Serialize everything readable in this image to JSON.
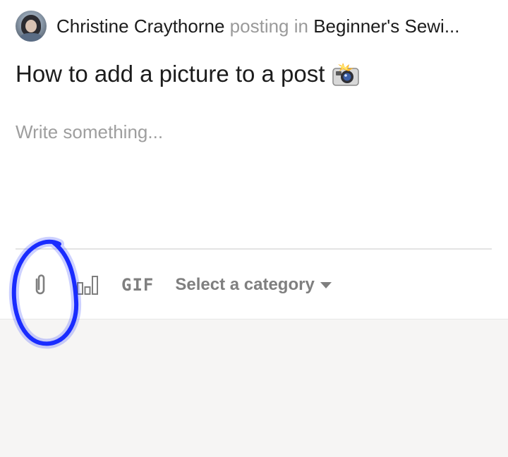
{
  "post": {
    "author": "Christine Craythorne",
    "posting_in_label": "posting in",
    "group": "Beginner's Sewi...",
    "title": "How to add a picture to a post",
    "body_placeholder": "Write something..."
  },
  "toolbar": {
    "attach_icon": "paperclip-icon",
    "poll_icon": "poll-chart-icon",
    "gif_label": "GIF",
    "category_label": "Select a category"
  },
  "colors": {
    "annotation": "#1a2cff",
    "muted_text": "#9a9a9a",
    "bottom_bg": "#f6f5f4"
  }
}
